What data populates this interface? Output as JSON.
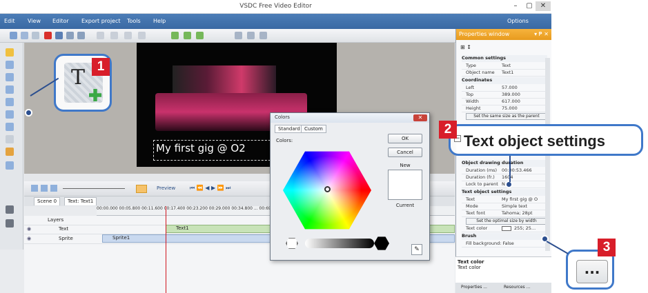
{
  "window": {
    "title": "VSDC Free Video Editor",
    "minimize": "–",
    "maximize": "▢",
    "close": "✕"
  },
  "menu": {
    "items": [
      "Edit",
      "View",
      "Editor",
      "Export project",
      "Tools",
      "Help"
    ],
    "options": "Options"
  },
  "canvas": {
    "overlay_text": "My first gig @ O2"
  },
  "timeline": {
    "preview": "Preview",
    "tabs": [
      "Scene 0",
      "Text: Text1"
    ],
    "ruler": "00:00.000  00:05.800  00:11.600  00:17.400  00:23.200  00:29.000  00:34.800 ... 00:69.600",
    "layers_label": "Layers",
    "rows": [
      {
        "name": "Text",
        "clip": "Text1"
      },
      {
        "name": "Sprite",
        "clip": "Sprite1"
      }
    ]
  },
  "colors_dialog": {
    "title": "Colors",
    "tabs": [
      "Standard",
      "Custom"
    ],
    "colors_label": "Colors:",
    "ok": "OK",
    "cancel": "Cancel",
    "new_label": "New",
    "current_label": "Current"
  },
  "properties": {
    "title": "Properties window",
    "pin": "▾ ₱ ✕",
    "common_settings": "Common settings",
    "type_key": "Type",
    "type_val": "Text",
    "object_name_key": "Object name",
    "object_name_val": "Text1",
    "coordinates": "Coordinates",
    "left_key": "Left",
    "left_val": "57.000",
    "top_key": "Top",
    "top_val": "389.000",
    "width_key": "Width",
    "width_val": "617.000",
    "height_key": "Height",
    "height_val": "75.000",
    "same_size_btn": "Set the same size as the parent",
    "object_drawing_duration": "Object drawing duration",
    "duration_ms_key": "Duration (ms)",
    "duration_ms_val": "00:00:53.466",
    "duration_frames_key": "Duration (fr.)",
    "duration_frames_val": "1604",
    "lock_key": "Lock to parent",
    "lock_val": "No",
    "text_object_settings": "Text object settings",
    "text_key": "Text",
    "text_val": "My first gig @ O",
    "mode_key": "Mode",
    "mode_val": "Simple text",
    "font_key": "Text font",
    "font_val": "Tahoma; 28pt",
    "optimal_btn": "Set the optimal size by width",
    "color_key": "Text color",
    "color_val": "255; 25...",
    "brush": "Brush",
    "fill_bg": "Fill background: False",
    "desc_title": "Text color",
    "desc_text": "Text color",
    "bottom_tabs": [
      "Properties ...",
      "Resources ..."
    ]
  },
  "callouts": {
    "one": "1",
    "two": "2",
    "three": "3",
    "two_text": "Text object settings",
    "three_glyph": "..."
  },
  "colors": {
    "callout_border": "#3f78c9",
    "badge": "#d81e2a",
    "menubar": "#3a69a3",
    "props_title": "#f6b33d"
  }
}
